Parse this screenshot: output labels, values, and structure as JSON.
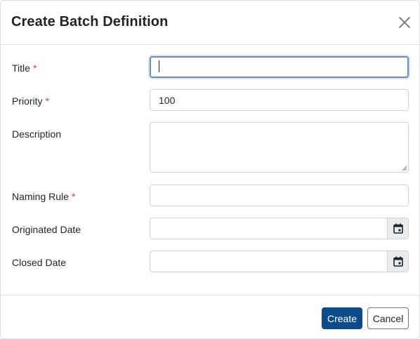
{
  "dialog": {
    "title": "Create Batch Definition",
    "close_icon": "close-icon"
  },
  "form": {
    "title": {
      "label": "Title",
      "required_mark": "*",
      "value": ""
    },
    "priority": {
      "label": "Priority",
      "required_mark": "*",
      "value": "100"
    },
    "description": {
      "label": "Description",
      "value": ""
    },
    "naming_rule": {
      "label": "Naming Rule",
      "required_mark": "*",
      "value": ""
    },
    "originated_date": {
      "label": "Originated Date",
      "value": "",
      "icon": "calendar-icon"
    },
    "closed_date": {
      "label": "Closed Date",
      "value": "",
      "icon": "calendar-icon"
    }
  },
  "footer": {
    "create_label": "Create",
    "cancel_label": "Cancel"
  },
  "colors": {
    "primary": "#0b4a8b",
    "required": "#dc3545",
    "focus_border": "#6c8fb5"
  }
}
